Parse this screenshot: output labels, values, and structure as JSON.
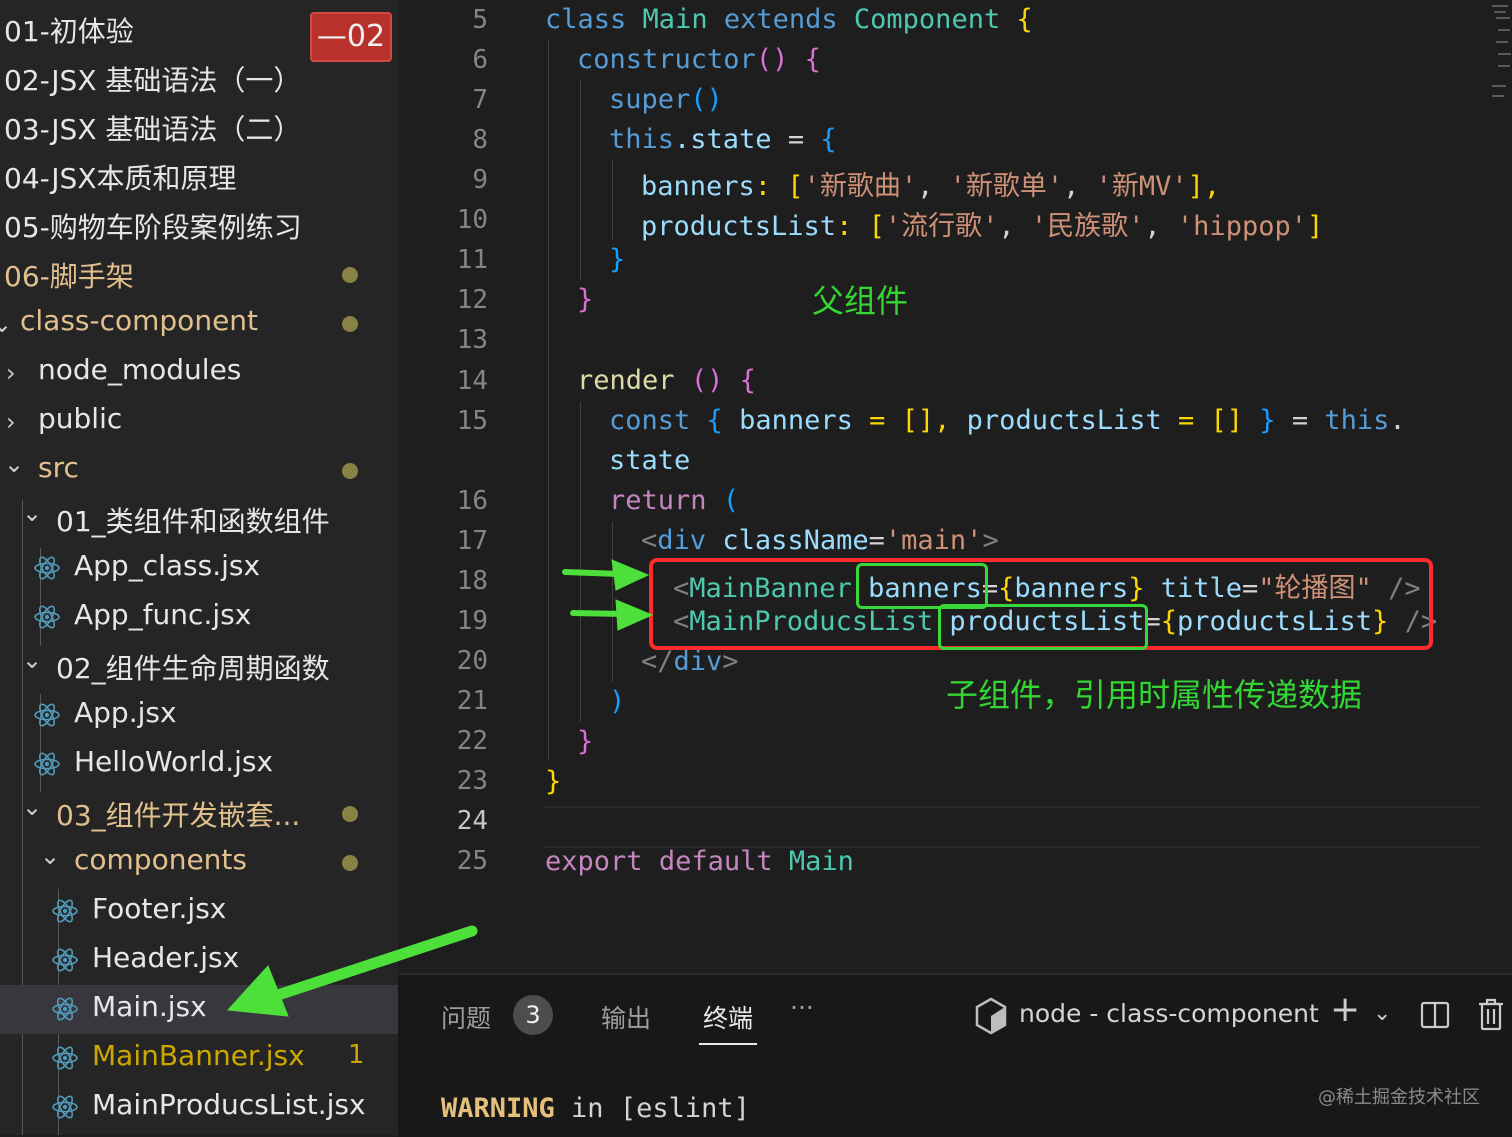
{
  "explorer": {
    "badge": "—02",
    "items": [
      {
        "label": "01-初体验",
        "modified": false
      },
      {
        "label": "02-JSX 基础语法（一）",
        "modified": false
      },
      {
        "label": "03-JSX 基础语法（二）",
        "modified": false
      },
      {
        "label": "04-JSX本质和原理",
        "modified": false
      },
      {
        "label": "05-购物车阶段案例练习",
        "modified": false
      },
      {
        "label": "06-脚手架",
        "modified": true
      },
      {
        "label": "class-component",
        "modified": true,
        "expanded": true
      },
      {
        "label": "node_modules",
        "modified": false,
        "expanded": false
      },
      {
        "label": "public",
        "modified": false,
        "expanded": false
      },
      {
        "label": "src",
        "modified": true,
        "expanded": true
      },
      {
        "label": "01_类组件和函数组件",
        "modified": false,
        "expanded": true
      },
      {
        "label": "App_class.jsx",
        "icon": "react-icon"
      },
      {
        "label": "App_func.jsx",
        "icon": "react-icon"
      },
      {
        "label": "02_组件生命周期函数",
        "modified": false,
        "expanded": true
      },
      {
        "label": "App.jsx",
        "icon": "react-icon"
      },
      {
        "label": "HelloWorld.jsx",
        "icon": "react-icon"
      },
      {
        "label": "03_组件开发嵌套...",
        "modified": true,
        "expanded": true
      },
      {
        "label": "components",
        "modified": true,
        "expanded": true
      },
      {
        "label": "Footer.jsx",
        "icon": "react-icon"
      },
      {
        "label": "Header.jsx",
        "icon": "react-icon"
      },
      {
        "label": "Main.jsx",
        "icon": "react-icon",
        "selected": true
      },
      {
        "label": "MainBanner.jsx",
        "icon": "react-icon",
        "problems": "1"
      },
      {
        "label": "MainProducsList.jsx",
        "icon": "react-icon"
      }
    ]
  },
  "editor": {
    "line_numbers": [
      "5",
      "6",
      "7",
      "8",
      "9",
      "10",
      "11",
      "12",
      "13",
      "14",
      "15",
      "",
      "16",
      "17",
      "18",
      "19",
      "20",
      "21",
      "22",
      "23",
      "24",
      "25"
    ],
    "current_line": "24",
    "code": {
      "l5": [
        "class",
        "Main",
        "extends",
        "Component",
        "{"
      ],
      "l6": [
        "constructor",
        "()",
        "{"
      ],
      "l7": [
        "super",
        "()"
      ],
      "l8": [
        "this",
        ".state",
        " = ",
        "{"
      ],
      "l9": [
        "banners",
        ": [",
        "'新歌曲'",
        ", ",
        "'新歌单'",
        ", ",
        "'新MV'",
        "],"
      ],
      "l10": [
        "productsList",
        ": [",
        "'流行歌'",
        ", ",
        "'民族歌'",
        ", ",
        "'hippop'",
        "]"
      ],
      "l11": [
        "}"
      ],
      "l12": [
        "}"
      ],
      "l14": [
        "render",
        "()",
        "{"
      ],
      "l15": [
        "const",
        "{",
        "banners",
        " = [], ",
        "productsList",
        " = [] ",
        "}",
        " = ",
        "this",
        "."
      ],
      "l15b": [
        "state"
      ],
      "l16": [
        "return",
        "("
      ],
      "l17": [
        "<",
        "div",
        "className",
        "=",
        "'main'",
        ">"
      ],
      "l18": [
        "<",
        "MainBanner",
        "banners",
        "=",
        "{",
        "banners",
        "}",
        "title",
        "=",
        "\"轮播图\"",
        "/>"
      ],
      "l19": [
        "<",
        "MainProducsList",
        "productsList",
        "=",
        "{",
        "productsList",
        "}",
        "/>"
      ],
      "l20": [
        "</",
        "div",
        ">"
      ],
      "l21": [
        ")"
      ],
      "l22": [
        "}"
      ],
      "l23": [
        "}"
      ],
      "l25": [
        "export",
        "default",
        "Main"
      ]
    },
    "annotations": {
      "parent": "父组件",
      "child": "子组件，引用时属性传递数据"
    }
  },
  "panel": {
    "tabs": [
      "问题",
      "输出",
      "终端"
    ],
    "problems_count": "3",
    "active_tab": "终端",
    "more": "···",
    "terminal_name": "node - class-component",
    "add": "+",
    "terminal_text": [
      "WARNING",
      " in [eslint]"
    ],
    "watermark": "@稀土掘金技术社区"
  },
  "colors": {
    "annotation_red": "#ff2a2a",
    "annotation_green": "#39d83a",
    "modified_folder": "#e2c08d",
    "react_icon": "#519aba"
  }
}
